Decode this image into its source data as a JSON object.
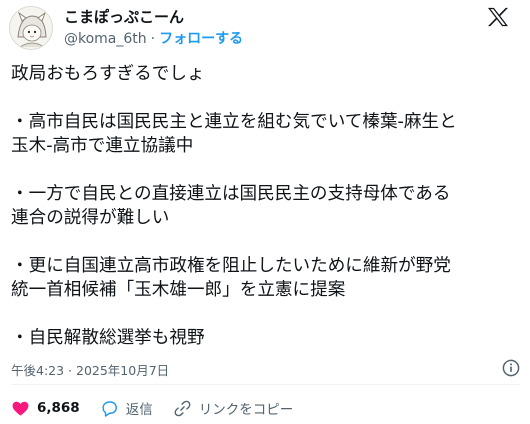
{
  "author": {
    "display_name": "こまぽっぷこーん",
    "handle": "@koma_6th",
    "separator": "·",
    "follow_label": "フォローする"
  },
  "tweet": {
    "lines": [
      "政局おもろすぎるでしょ",
      "",
      "・高市自民は国民民主と連立を組む気でいて榛葉-麻生と",
      "玉木-高市で連立協議中",
      "",
      "・一方で自民との直接連立は国民民主の支持母体である",
      "連合の説得が難しい",
      "",
      "・更に自国連立高市政権を阻止したいために維新が野党",
      "統一首相候補「玉木雄一郎」を立憲に提案",
      "",
      "・自民解散総選挙も視野"
    ]
  },
  "meta": {
    "timestamp": "午後4:23 · 2025年10月7日"
  },
  "actions": {
    "like_count": "6,868",
    "reply_label": "返信",
    "copy_link_label": "リンクをコピー"
  },
  "colors": {
    "text": "#0f1419",
    "secondary": "#536471",
    "link": "#1d9bf0",
    "like": "#f91880",
    "divider": "#eff3f4"
  },
  "icons": [
    "x-logo-icon",
    "info-icon",
    "heart-icon",
    "reply-icon",
    "link-icon"
  ]
}
